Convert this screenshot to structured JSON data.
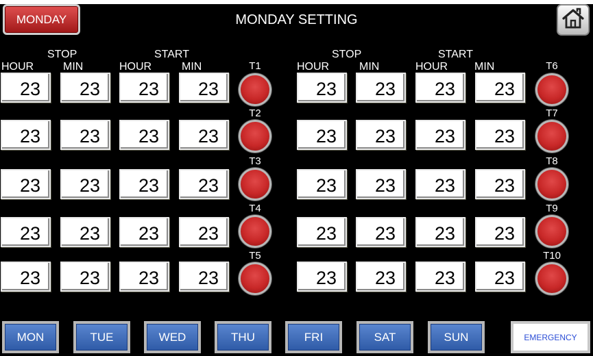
{
  "header": {
    "day_badge": "MONDAY",
    "title": "MONDAY SETTING",
    "home_icon": "home-icon"
  },
  "column_labels": {
    "stop": "STOP",
    "start": "START",
    "hour": "HOUR",
    "min": "MIN"
  },
  "left_timers": [
    {
      "label": "T1",
      "stop_hour": "23",
      "stop_min": "23",
      "start_hour": "23",
      "start_min": "23"
    },
    {
      "label": "T2",
      "stop_hour": "23",
      "stop_min": "23",
      "start_hour": "23",
      "start_min": "23"
    },
    {
      "label": "T3",
      "stop_hour": "23",
      "stop_min": "23",
      "start_hour": "23",
      "start_min": "23"
    },
    {
      "label": "T4",
      "stop_hour": "23",
      "stop_min": "23",
      "start_hour": "23",
      "start_min": "23"
    },
    {
      "label": "T5",
      "stop_hour": "23",
      "stop_min": "23",
      "start_hour": "23",
      "start_min": "23"
    }
  ],
  "right_timers": [
    {
      "label": "T6",
      "stop_hour": "23",
      "stop_min": "23",
      "start_hour": "23",
      "start_min": "23"
    },
    {
      "label": "T7",
      "stop_hour": "23",
      "stop_min": "23",
      "start_hour": "23",
      "start_min": "23"
    },
    {
      "label": "T8",
      "stop_hour": "23",
      "stop_min": "23",
      "start_hour": "23",
      "start_min": "23"
    },
    {
      "label": "T9",
      "stop_hour": "23",
      "stop_min": "23",
      "start_hour": "23",
      "start_min": "23"
    },
    {
      "label": "T10",
      "stop_hour": "23",
      "stop_min": "23",
      "start_hour": "23",
      "start_min": "23"
    }
  ],
  "day_nav": [
    "MON",
    "TUE",
    "WED",
    "THU",
    "FRI",
    "SAT",
    "SUN"
  ],
  "emergency_label": "EMERGENCY",
  "colors": {
    "background": "#000000",
    "lamp_red": "#c82828",
    "nav_blue": "#3e6ab8",
    "badge_red": "#c03030",
    "emergency_text": "#2b4dd6"
  }
}
